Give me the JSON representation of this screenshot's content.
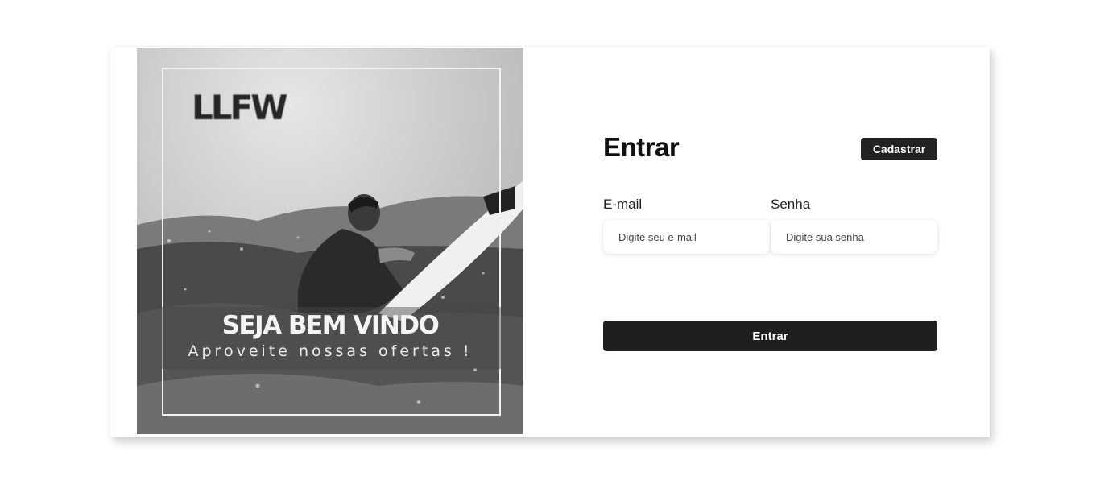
{
  "hero": {
    "logo_text": "LLFW",
    "headline": "SEJA BEM VINDO",
    "tagline": "Aproveite nossas ofertas !"
  },
  "form": {
    "title": "Entrar",
    "register_label": "Cadastrar",
    "email": {
      "label": "E-mail",
      "placeholder": "Digite seu e-mail",
      "value": ""
    },
    "password": {
      "label": "Senha",
      "placeholder": "Digite sua senha",
      "value": ""
    },
    "submit_label": "Entrar"
  },
  "colors": {
    "button_bg": "#1f1f21",
    "button_text": "#ffffff",
    "page_bg": "#ffffff"
  }
}
